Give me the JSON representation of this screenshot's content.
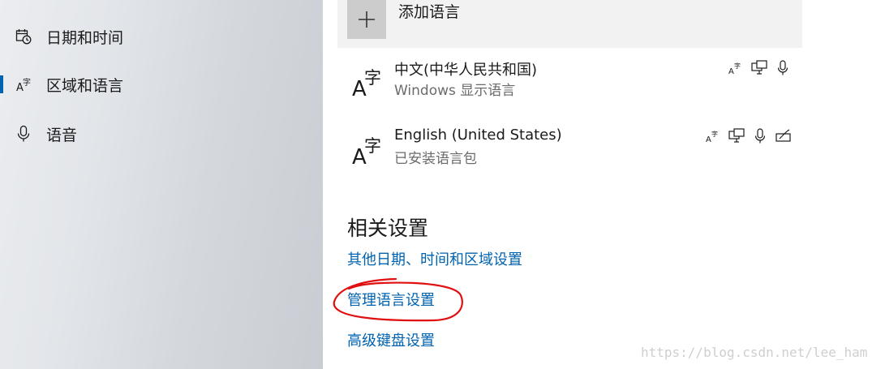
{
  "sidebar": {
    "items": [
      {
        "label": "日期和时间",
        "icon": "calendar-clock-icon",
        "selected": false
      },
      {
        "label": "区域和语言",
        "icon": "language-icon",
        "selected": true
      },
      {
        "label": "语音",
        "icon": "microphone-icon",
        "selected": false
      }
    ]
  },
  "main": {
    "add_language_label": "添加语言",
    "languages": [
      {
        "name": "中文(中华人民共和国)",
        "subtitle": "Windows 显示语言",
        "features": [
          "language-pack-icon",
          "display-language-icon",
          "speech-icon"
        ]
      },
      {
        "name": "English (United States)",
        "subtitle": "已安装语言包",
        "features": [
          "language-pack-icon",
          "display-language-icon",
          "speech-icon",
          "handwriting-icon"
        ]
      }
    ],
    "related_settings": {
      "title": "相关设置",
      "links": [
        "其他日期、时间和区域设置",
        "管理语言设置",
        "高级键盘设置"
      ]
    }
  },
  "annotation": {
    "circled_link": "管理语言设置",
    "color": "#e01010"
  },
  "watermark": "https://blog.csdn.net/lee_ham",
  "colors": {
    "accent": "#0063b1",
    "text": "#1a1a1a",
    "secondary_text": "#6b6b6b"
  }
}
